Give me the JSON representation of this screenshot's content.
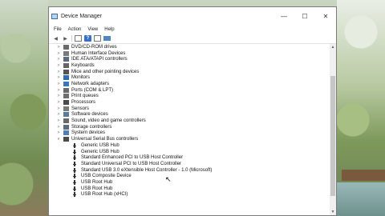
{
  "window": {
    "title": "Device Manager",
    "controls": {
      "minimize": "—",
      "maximize": "☐",
      "close": "✕"
    }
  },
  "menu": [
    "File",
    "Action",
    "View",
    "Help"
  ],
  "toolbar": [
    "back-icon",
    "forward-icon",
    "properties-icon",
    "help-icon",
    "device-icon",
    "monitor-icon"
  ],
  "tree": {
    "categories": [
      {
        "label": "DVD/CD-ROM drives",
        "icon": "dvd-drive-icon",
        "color": "#6b6b6b"
      },
      {
        "label": "Human Interface Devices",
        "icon": "hid-icon",
        "color": "#7a7a7a"
      },
      {
        "label": "IDE ATA/ATAPI controllers",
        "icon": "ide-controller-icon",
        "color": "#5b6c7f"
      },
      {
        "label": "Keyboards",
        "icon": "keyboard-icon",
        "color": "#666666"
      },
      {
        "label": "Mice and other pointing devices",
        "icon": "mouse-icon",
        "color": "#555555"
      },
      {
        "label": "Monitors",
        "icon": "monitor-icon",
        "color": "#2f6db0"
      },
      {
        "label": "Network adapters",
        "icon": "network-adapter-icon",
        "color": "#3a77b8"
      },
      {
        "label": "Ports (COM & LPT)",
        "icon": "port-icon",
        "color": "#6a6a6a"
      },
      {
        "label": "Print queues",
        "icon": "printer-icon",
        "color": "#707070"
      },
      {
        "label": "Processors",
        "icon": "processor-icon",
        "color": "#4a4a4a"
      },
      {
        "label": "Sensors",
        "icon": "sensor-icon",
        "color": "#7a7a7a"
      },
      {
        "label": "Software devices",
        "icon": "software-device-icon",
        "color": "#5a7aa0"
      },
      {
        "label": "Sound, video and game controllers",
        "icon": "sound-icon",
        "color": "#6a6a6a"
      },
      {
        "label": "Storage controllers",
        "icon": "storage-controller-icon",
        "color": "#5b6c7f"
      },
      {
        "label": "System devices",
        "icon": "system-device-icon",
        "color": "#4f7fb8"
      },
      {
        "label": "Universal Serial Bus controllers",
        "icon": "usb-controller-icon",
        "color": "#4a4a4a"
      }
    ],
    "usb_children": [
      "Generic USB Hub",
      "Generic USB Hub",
      "Standard Enhanced PCI to USB Host Controller",
      "Standard Universal PCI to USB Host Controller",
      "Standard USB 3.0 eXtensible Host Controller - 1.0 (Microsoft)",
      "USB Composite Device",
      "USB Root Hub",
      "USB Root Hub",
      "USB Root Hub (xHCI)"
    ],
    "collapsed_glyph": ">",
    "expanded_glyph": "v"
  }
}
